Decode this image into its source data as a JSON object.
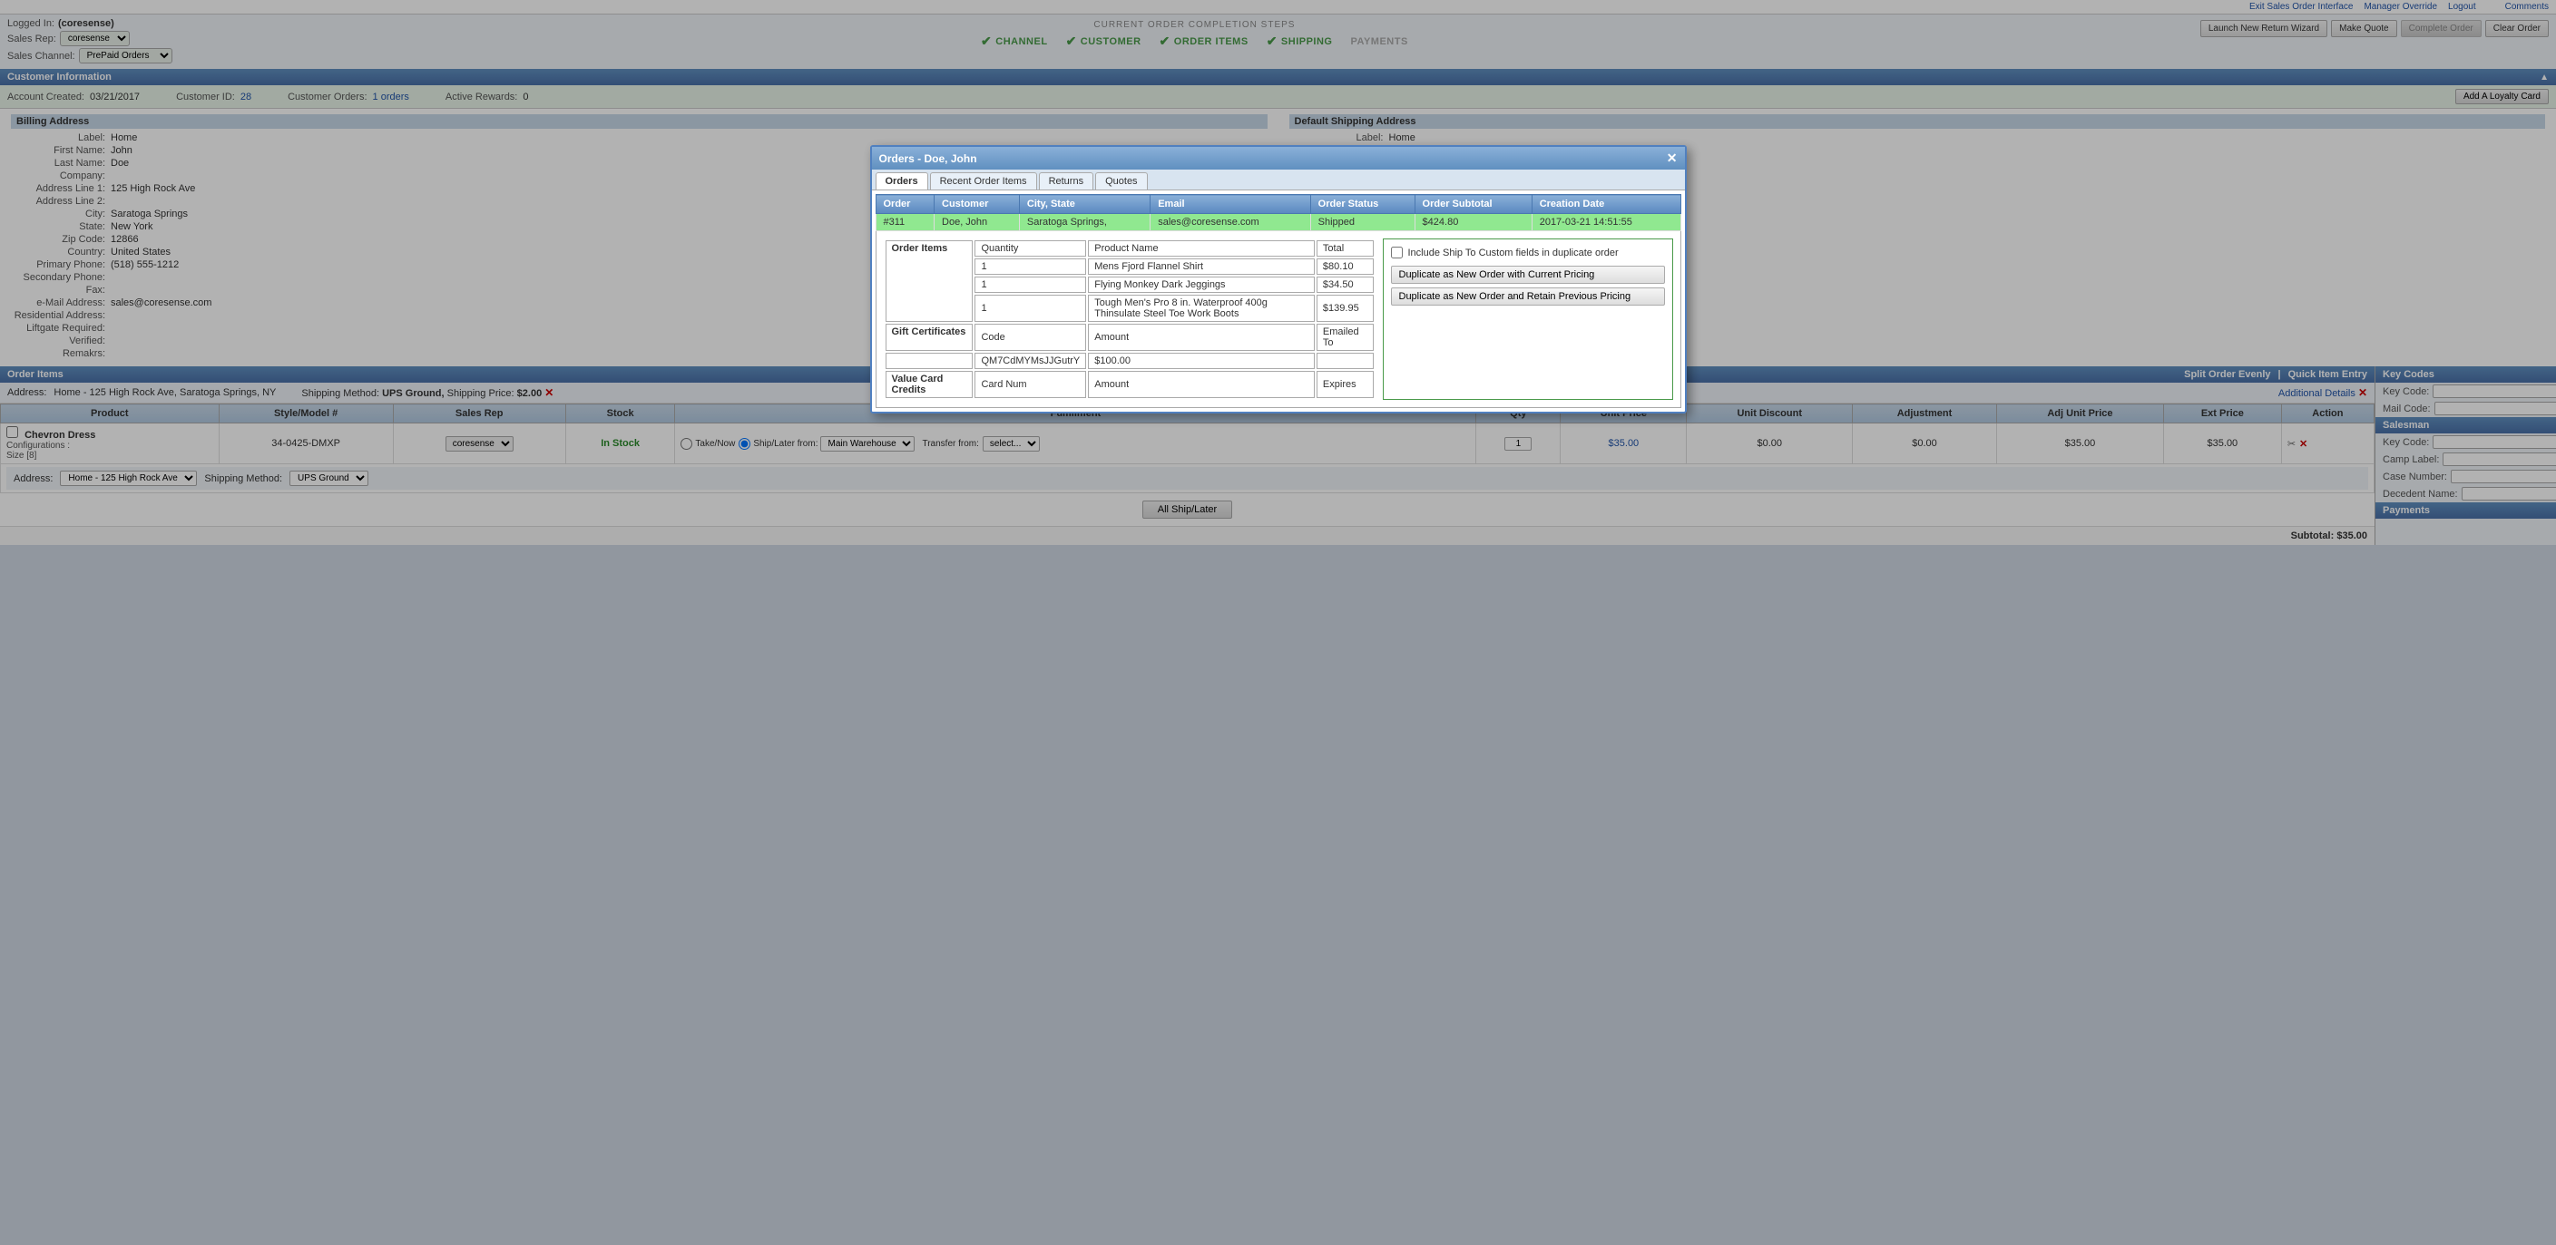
{
  "topbar": {
    "exit_label": "Exit Sales Order Interface",
    "manager_label": "Manager Override",
    "logout_label": "Logout",
    "comments_label": "Comments"
  },
  "header": {
    "logged_in_label": "Logged In:",
    "logged_in_value": "(coresense)",
    "sales_rep_label": "Sales Rep:",
    "sales_rep_value": "coresense",
    "sales_channel_label": "Sales Channel:",
    "sales_channel_value": "PrePaid Orders"
  },
  "steps": {
    "title": "CURRENT ORDER COMPLETION STEPS",
    "items": [
      {
        "label": "CHANNEL",
        "active": true
      },
      {
        "label": "CUSTOMER",
        "active": true
      },
      {
        "label": "ORDER ITEMS",
        "active": true
      },
      {
        "label": "SHIPPING",
        "active": true
      },
      {
        "label": "PAYMENTS",
        "active": false
      }
    ]
  },
  "action_buttons": {
    "return_wizard": "Launch New Return Wizard",
    "make_quote": "Make Quote",
    "complete_order": "Complete Order",
    "clear_order": "Clear Order"
  },
  "customer_section": {
    "title": "Customer Information",
    "account_created_label": "Account Created:",
    "account_created_value": "03/21/2017",
    "customer_id_label": "Customer ID:",
    "customer_id_value": "28",
    "customer_orders_label": "Customer Orders:",
    "customer_orders_value": "1 orders",
    "active_rewards_label": "Active Rewards:",
    "active_rewards_value": "0",
    "loyalty_btn": "Add A Loyalty Card"
  },
  "billing": {
    "section_title": "Billing Address",
    "label_label": "Label:",
    "label_value": "Home",
    "first_name_label": "First Name:",
    "first_name_value": "John",
    "last_name_label": "Last Name:",
    "last_name_value": "Doe",
    "company_label": "Company:",
    "company_value": "",
    "address1_label": "Address Line 1:",
    "address1_value": "125 High Rock Ave",
    "address2_label": "Address Line 2:",
    "address2_value": "",
    "city_label": "City:",
    "city_value": "Saratoga Springs",
    "state_label": "State:",
    "state_value": "New York",
    "zip_label": "Zip Code:",
    "zip_value": "12866",
    "country_label": "Country:",
    "country_value": "United States",
    "primary_phone_label": "Primary Phone:",
    "primary_phone_value": "(518) 555-1212",
    "secondary_phone_label": "Secondary Phone:",
    "secondary_phone_value": "",
    "fax_label": "Fax:",
    "fax_value": "",
    "email_label": "e-Mail Address:",
    "email_value": "sales@coresense.com",
    "residential_label": "Residential Address:",
    "residential_value": "",
    "liftgate_label": "Liftgate Required:",
    "liftgate_value": "",
    "verified_label": "Verified:",
    "verified_value": "",
    "remarks_label": "Remakrs:",
    "remarks_value": ""
  },
  "shipping": {
    "section_title": "Default Shipping Address",
    "label_label": "Label:",
    "label_value": "Home"
  },
  "modal": {
    "title": "Orders - Doe, John",
    "tabs": [
      "Orders",
      "Recent Order Items",
      "Returns",
      "Quotes"
    ],
    "active_tab": "Orders",
    "table_headers": [
      "Order",
      "Customer",
      "City, State",
      "Email",
      "Order Status",
      "Order Subtotal",
      "Creation Date"
    ],
    "orders": [
      {
        "order": "#311",
        "customer": "Doe, John",
        "city_state": "Saratoga Springs,",
        "email": "sales@coresense.com",
        "status": "Shipped",
        "subtotal": "$424.80",
        "creation_date": "2017-03-21  14:51:55",
        "selected": true
      }
    ],
    "order_items_label": "Order Items",
    "order_items": [
      {
        "qty": "1",
        "name": "Mens Fjord Flannel Shirt",
        "total": "$80.10"
      },
      {
        "qty": "1",
        "name": "Flying Monkey Dark Jeggings",
        "total": "$34.50"
      },
      {
        "qty": "1",
        "name": "Tough Men's Pro 8 in. Waterproof 400g Thinsulate Steel Toe Work Boots",
        "total": "$139.95"
      }
    ],
    "gift_cert_label": "Gift Certificates",
    "gift_cert_headers": [
      "Code",
      "Amount",
      "Emailed To"
    ],
    "gift_cert_row": {
      "code": "QM7CdMYMsJJGutrY",
      "amount": "$100.00",
      "emailed_to": ""
    },
    "value_card_label": "Value Card Credits",
    "value_card_headers": [
      "Card Num",
      "Amount",
      "Expires"
    ],
    "include_ship_label": "Include Ship To Custom fields in duplicate order",
    "duplicate_btn1": "Duplicate as New Order with Current Pricing",
    "duplicate_btn2": "Duplicate as New Order and Retain Previous Pricing"
  },
  "order_items_section": {
    "title": "Order Items",
    "split_btn": "Split Order Evenly",
    "quick_entry_btn": "Quick Item Entry",
    "additional_details": "Additional Details",
    "address_label": "Address:",
    "address_value": "Home - 125 High Rock Ave, Saratoga Springs, NY",
    "shipping_method_label": "Shipping Method:",
    "shipping_method_value": "UPS Ground,",
    "shipping_price_label": "Shipping Price:",
    "shipping_price_value": "$2.00",
    "table_headers": {
      "product": "Product",
      "style_model": "Style/Model #",
      "sales_rep": "Sales Rep",
      "stock": "Stock",
      "fulfillment": "Fulfillment",
      "qty": "Qty",
      "unit_price": "Unit Price",
      "unit_discount": "Unit Discount",
      "adjustment": "Adjustment",
      "adj_unit_price": "Adj Unit Price",
      "ext_price": "Ext Price",
      "action": "Action"
    },
    "items": [
      {
        "product_name": "Chevron Dress",
        "product_config": "Configurations :\nSize [8]",
        "style_model": "34-0425-DMXP",
        "sales_rep": "coresense",
        "stock": "In Stock",
        "fulfillment_type": "Ship/Later from:",
        "fulfillment_location": "Main Warehouse",
        "transfer_from": "select...",
        "qty": "1",
        "unit_price": "$35.00",
        "unit_discount": "$0.00",
        "adjustment": "$0.00",
        "adj_unit_price": "$35.00",
        "ext_price": "$35.00"
      }
    ],
    "item_address_label": "Address:",
    "item_address_value": "Home - 125 High Rock Ave",
    "ship_method_label": "Shipping Method:",
    "ship_method_value": "UPS Ground",
    "all_ship_btn": "All Ship/Later",
    "subtotal_label": "Subtotal:",
    "subtotal_value": "$35.00"
  },
  "right_sidebar": {
    "key_codes_title": "Key Codes",
    "key_code_label": "Key Code:",
    "mail_code_label": "Mail Code:",
    "salesman_title": "Salesman",
    "salesman_key_code_label": "Key Code:",
    "camp_label_label": "Camp Label:",
    "case_number_label": "Case Number:",
    "decedent_label": "Decedent Name:",
    "payments_title": "Payments"
  }
}
